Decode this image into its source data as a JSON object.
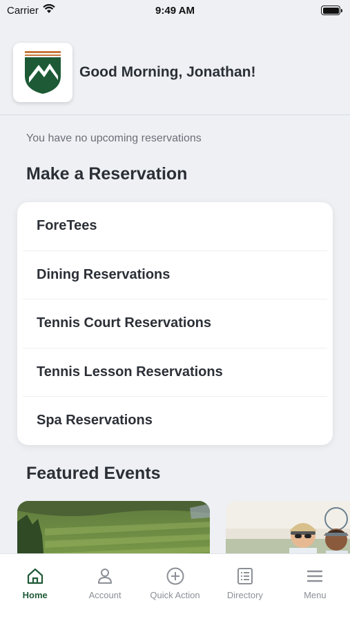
{
  "status_bar": {
    "carrier": "Carrier",
    "time": "9:49 AM"
  },
  "header": {
    "greeting": "Good Morning, Jonathan!",
    "logo_icon": "club-crest-logo",
    "colors": {
      "crest_green": "#1d5a35",
      "crest_orange": "#c8773a"
    }
  },
  "main": {
    "no_reservations_text": "You have no upcoming reservations",
    "make_reservation_title": "Make a Reservation",
    "reservation_items": [
      {
        "label": "ForeTees"
      },
      {
        "label": "Dining Reservations"
      },
      {
        "label": "Tennis Court Reservations"
      },
      {
        "label": "Tennis Lesson Reservations"
      },
      {
        "label": "Spa Reservations"
      }
    ],
    "featured_events_title": "Featured Events",
    "featured_events": [
      {
        "image": "golf-course-photo"
      },
      {
        "image": "tennis-players-photo"
      }
    ]
  },
  "tab_bar": {
    "accent": "#1f5a37",
    "tabs": [
      {
        "label": "Home",
        "icon": "home-icon",
        "active": true
      },
      {
        "label": "Account",
        "icon": "person-icon",
        "active": false
      },
      {
        "label": "Quick Action",
        "icon": "plus-circle-icon",
        "active": false
      },
      {
        "label": "Directory",
        "icon": "list-icon",
        "active": false
      },
      {
        "label": "Menu",
        "icon": "hamburger-icon",
        "active": false
      }
    ]
  }
}
